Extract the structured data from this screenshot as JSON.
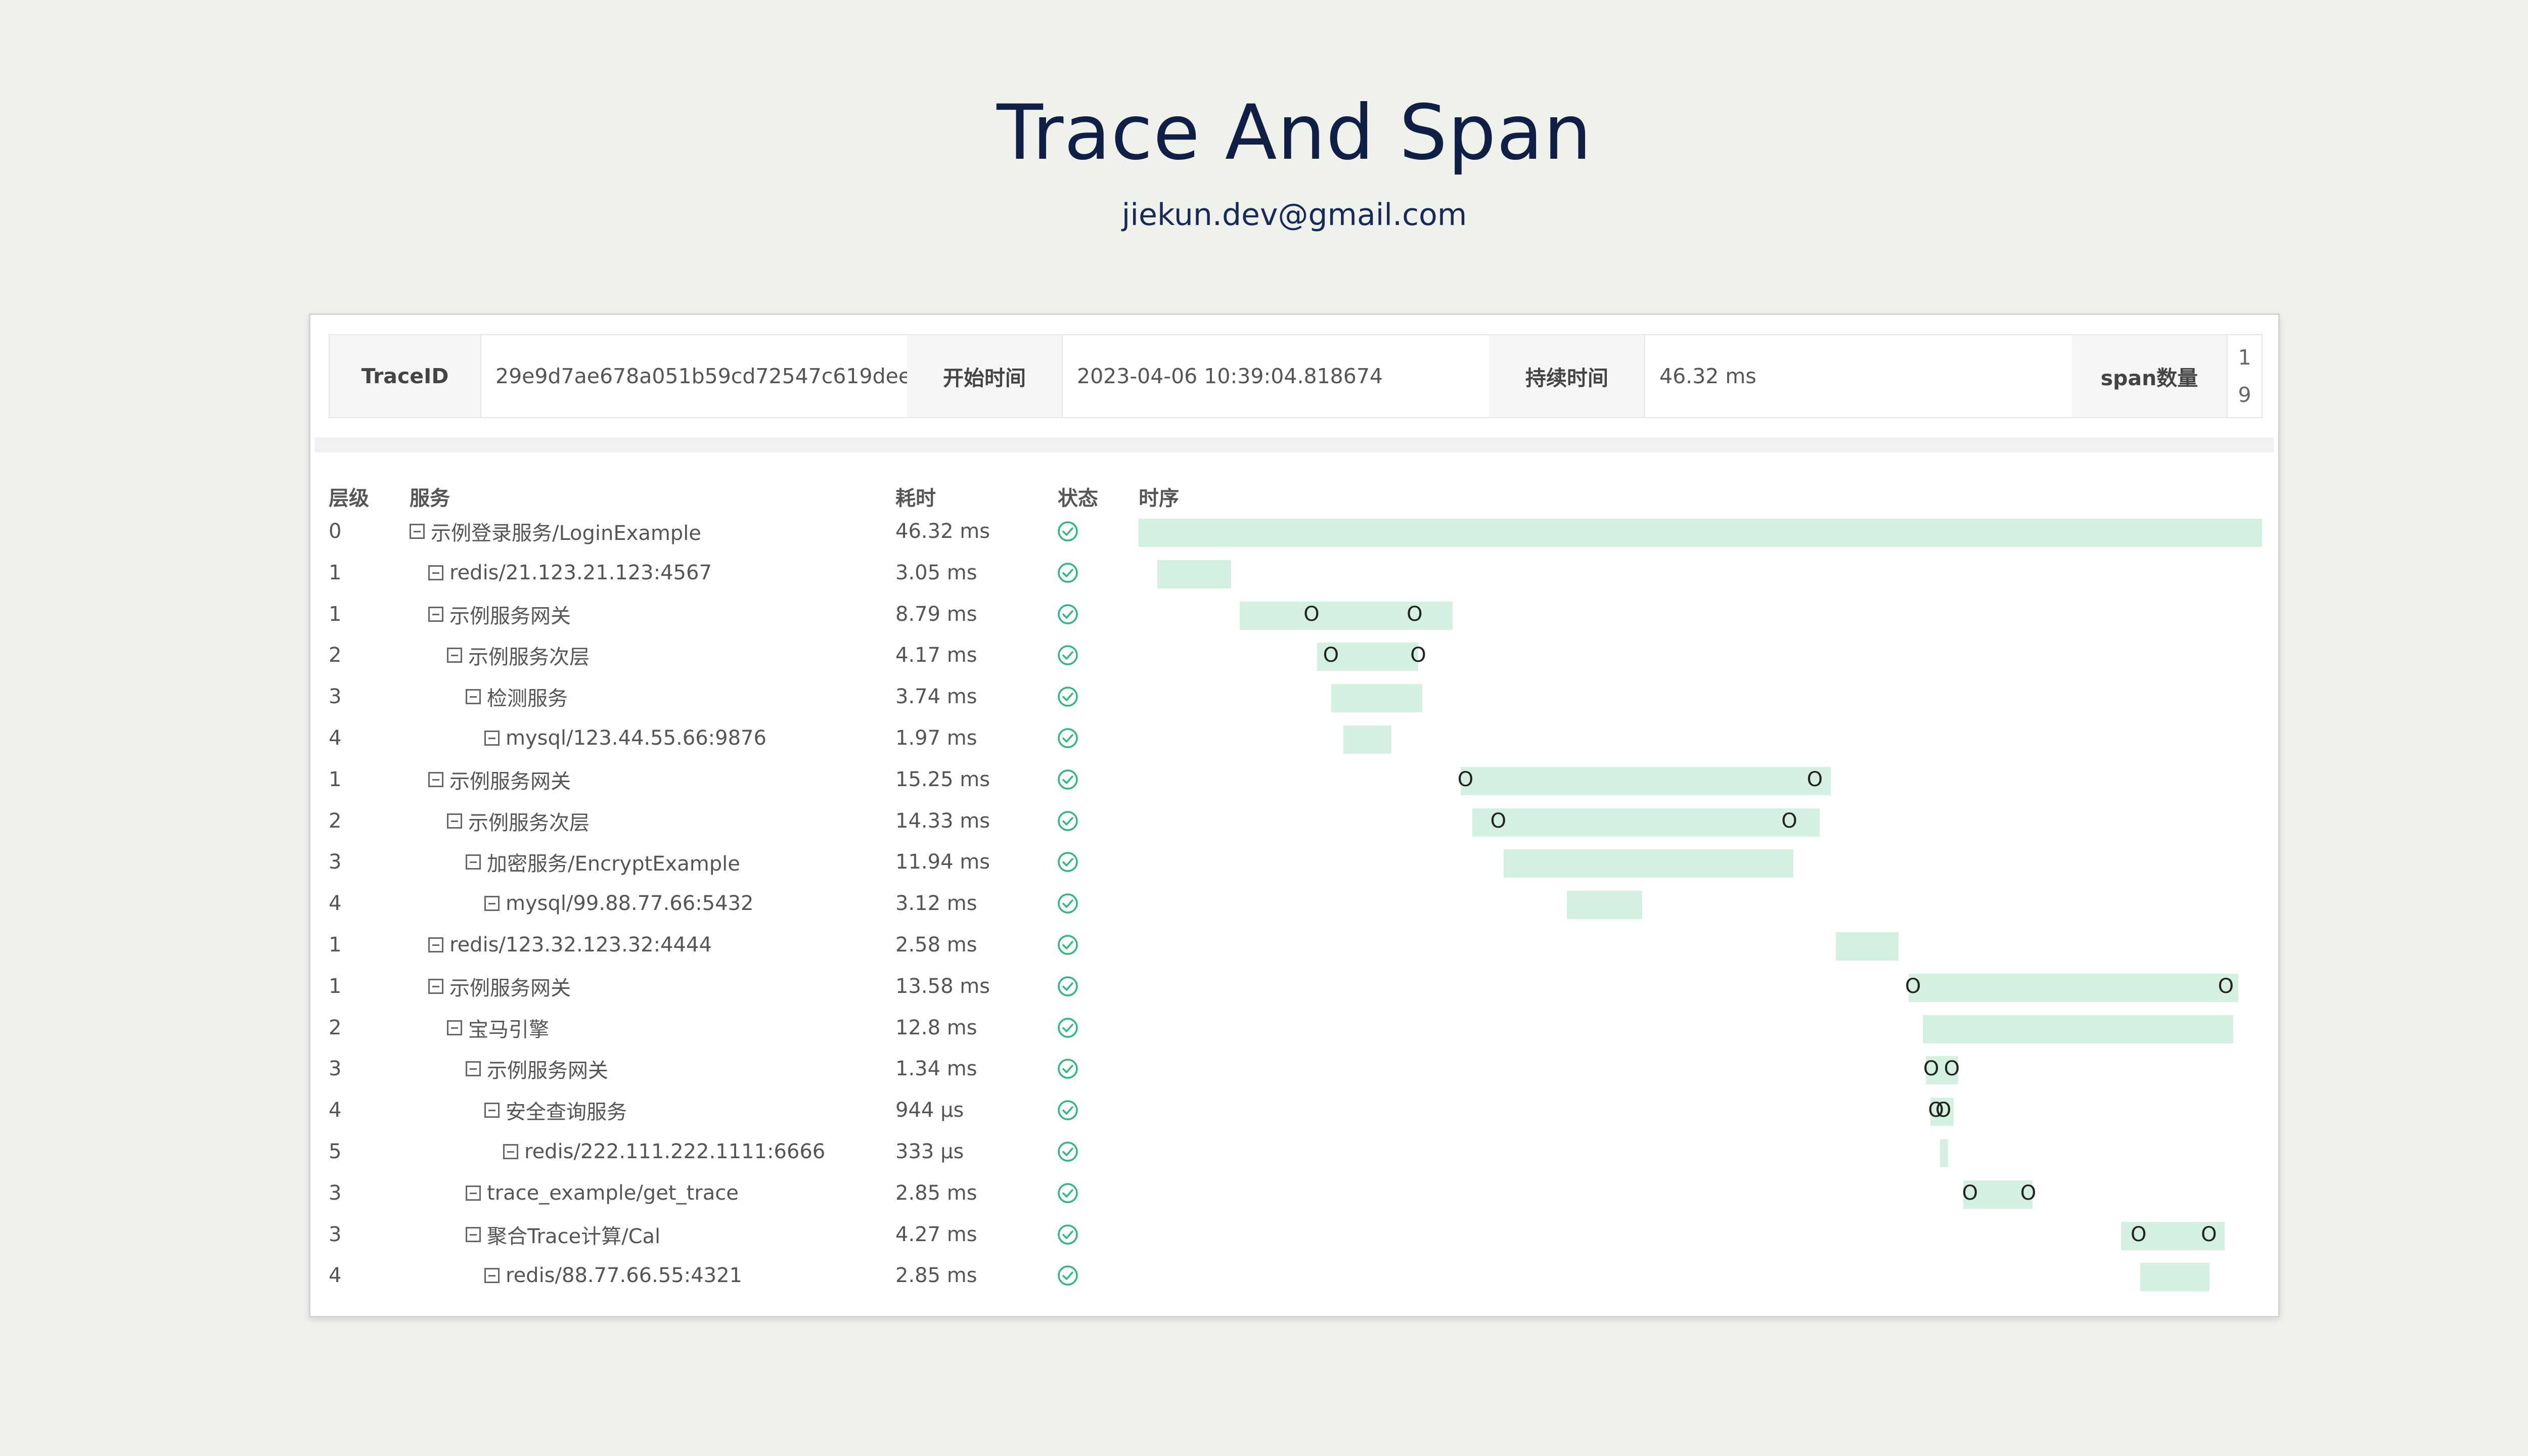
{
  "title": "Trace And Span",
  "subtitle": "jiekun.dev@gmail.com",
  "info": {
    "traceid_label": "TraceID",
    "traceid": "29e9d7ae678a051b59cd72547c619dee",
    "start_label": "开始时间",
    "start": "2023-04-06 10:39:04.818674",
    "duration_label": "持续时间",
    "duration": "46.32 ms",
    "span_label": "span数量",
    "span_count_line1": "1",
    "span_count_line2": "9"
  },
  "headers": {
    "level": "层级",
    "service": "服务",
    "duration": "耗时",
    "status": "状态",
    "timeline": "时序"
  },
  "colors": {
    "bar": "#d3f0e0",
    "status_ok": "#2db87d",
    "title": "#0f1f45",
    "background": "#eff1eb"
  },
  "icons": {
    "tree": "minus-square-icon",
    "status": "check-circle-icon"
  },
  "trace_total_ms": 46.32,
  "spans": [
    {
      "level": "0",
      "service": "示例登录服务/LoginExample",
      "duration": "46.32 ms",
      "start_ms": 0.0,
      "dur_ms": 46.32,
      "ticks": []
    },
    {
      "level": "1",
      "service": "redis/21.123.21.123:4567",
      "duration": "3.05 ms",
      "start_ms": 0.77,
      "dur_ms": 3.05,
      "ticks": []
    },
    {
      "level": "1",
      "service": "示例服务网关",
      "duration": "8.79 ms",
      "start_ms": 4.16,
      "dur_ms": 8.79,
      "ticks": [
        7.05,
        11.3
      ]
    },
    {
      "level": "2",
      "service": "示例服务次层",
      "duration": "4.17 ms",
      "start_ms": 7.35,
      "dur_ms": 4.17,
      "ticks": [
        7.85,
        11.45
      ]
    },
    {
      "level": "3",
      "service": "检测服务",
      "duration": "3.74 ms",
      "start_ms": 7.95,
      "dur_ms": 3.74,
      "ticks": []
    },
    {
      "level": "4",
      "service": "mysql/123.44.55.66:9876",
      "duration": "1.97 ms",
      "start_ms": 8.45,
      "dur_ms": 1.97,
      "ticks": []
    },
    {
      "level": "1",
      "service": "示例服务网关",
      "duration": "15.25 ms",
      "start_ms": 13.28,
      "dur_ms": 15.25,
      "ticks": [
        13.4,
        27.8
      ]
    },
    {
      "level": "2",
      "service": "示例服务次层",
      "duration": "14.33 ms",
      "start_ms": 13.75,
      "dur_ms": 14.33,
      "ticks": [
        14.75,
        26.75
      ]
    },
    {
      "level": "3",
      "service": "加密服务/EncryptExample",
      "duration": "11.94 ms",
      "start_ms": 15.05,
      "dur_ms": 11.94,
      "ticks": []
    },
    {
      "level": "4",
      "service": "mysql/99.88.77.66:5432",
      "duration": "3.12 ms",
      "start_ms": 17.65,
      "dur_ms": 3.12,
      "ticks": []
    },
    {
      "level": "1",
      "service": "redis/123.32.123.32:4444",
      "duration": "2.58 ms",
      "start_ms": 28.75,
      "dur_ms": 2.58,
      "ticks": []
    },
    {
      "level": "1",
      "service": "示例服务网关",
      "duration": "13.58 ms",
      "start_ms": 31.75,
      "dur_ms": 13.58,
      "ticks": [
        31.85,
        44.75
      ]
    },
    {
      "level": "2",
      "service": "宝马引擎",
      "duration": "12.8 ms",
      "start_ms": 32.33,
      "dur_ms": 12.8,
      "ticks": []
    },
    {
      "level": "3",
      "service": "示例服务网关",
      "duration": "1.34 ms",
      "start_ms": 32.45,
      "dur_ms": 1.34,
      "ticks": [
        32.6,
        33.45
      ]
    },
    {
      "level": "4",
      "service": "安全查询服务",
      "duration": "944 µs",
      "start_ms": 32.65,
      "dur_ms": 0.944,
      "ticks": [
        32.8,
        33.1
      ]
    },
    {
      "level": "5",
      "service": "redis/222.111.222.1111:6666",
      "duration": "333 µs",
      "start_ms": 33.05,
      "dur_ms": 0.333,
      "ticks": []
    },
    {
      "level": "3",
      "service": "trace_example/get_trace",
      "duration": "2.85 ms",
      "start_ms": 34.0,
      "dur_ms": 2.85,
      "ticks": [
        34.2,
        36.6
      ]
    },
    {
      "level": "3",
      "service": "聚合Trace计算/Cal",
      "duration": "4.27 ms",
      "start_ms": 40.5,
      "dur_ms": 4.27,
      "ticks": [
        41.15,
        44.05
      ]
    },
    {
      "level": "4",
      "service": "redis/88.77.66.55:4321",
      "duration": "2.85 ms",
      "start_ms": 41.3,
      "dur_ms": 2.85,
      "ticks": []
    }
  ]
}
